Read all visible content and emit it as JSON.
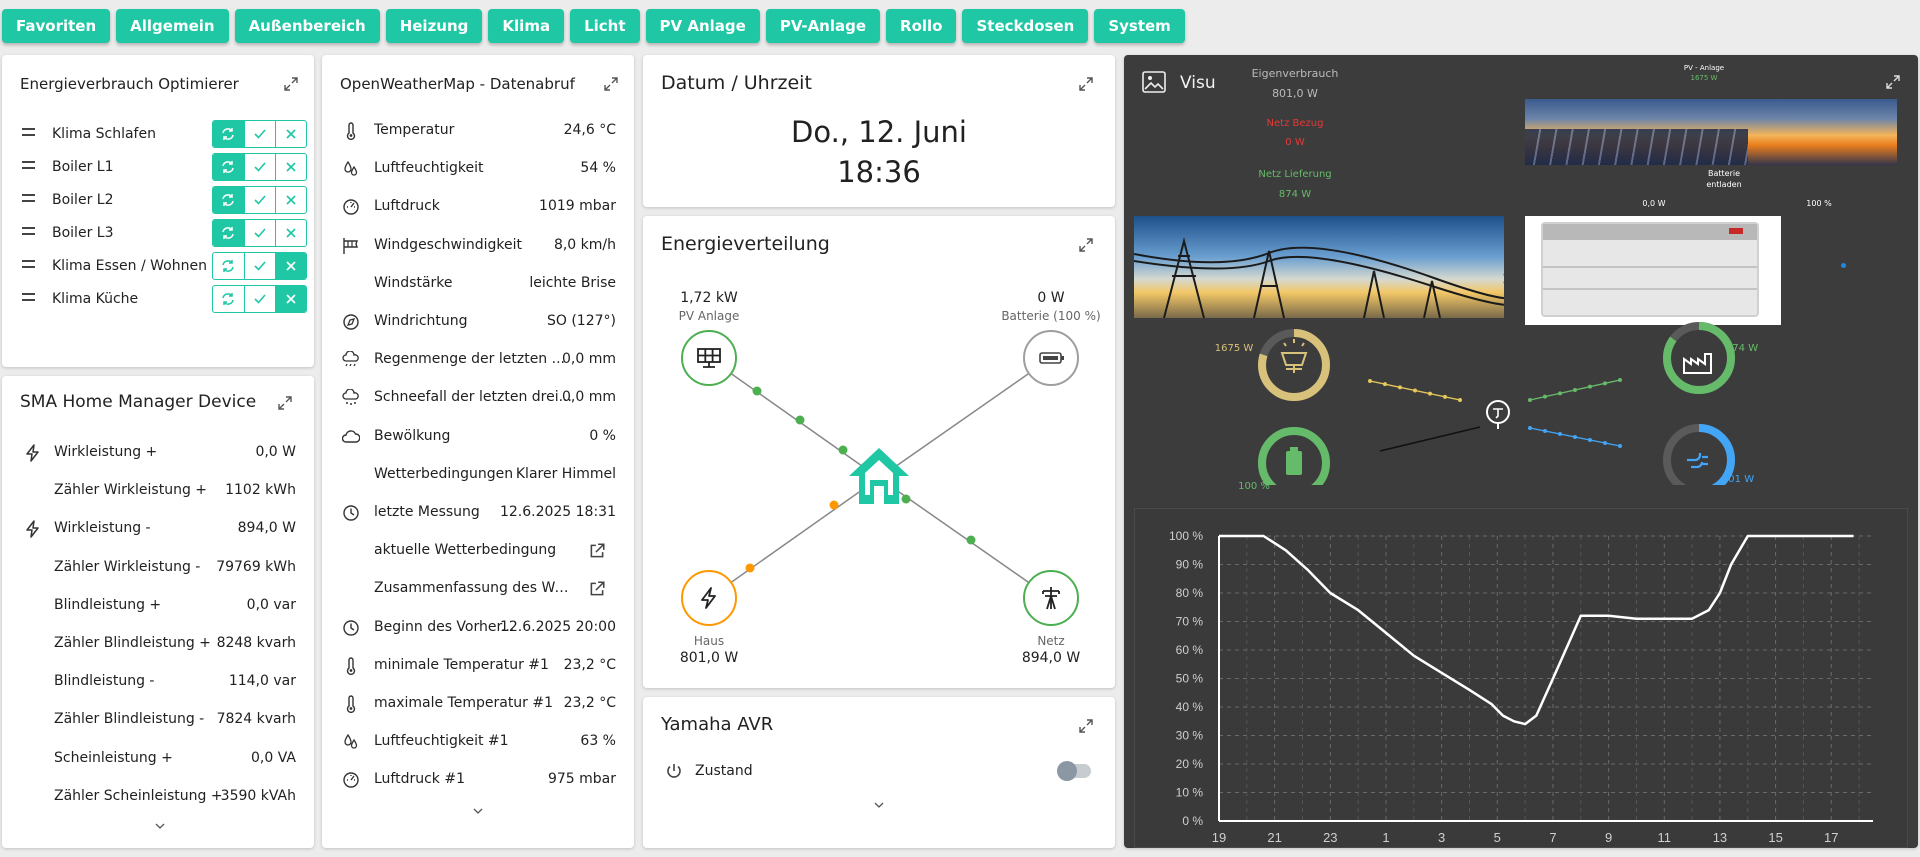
{
  "tabs": [
    "Favoriten",
    "Allgemein",
    "Außenbereich",
    "Heizung",
    "Klima",
    "Licht",
    "PV Anlage",
    "PV-Anlage",
    "Rollo",
    "Steckdosen",
    "System"
  ],
  "optimizer": {
    "title": "Energieverbrauch Optimierer",
    "items": [
      {
        "label": "Klima Schlafen",
        "active": "auto"
      },
      {
        "label": "Boiler L1",
        "active": "auto"
      },
      {
        "label": "Boiler L2",
        "active": "auto"
      },
      {
        "label": "Boiler L3",
        "active": "auto"
      },
      {
        "label": "Klima Essen / Wohnen",
        "active": "off"
      },
      {
        "label": "Klima Küche",
        "active": "off"
      }
    ]
  },
  "sma": {
    "title": "SMA Home Manager Device",
    "rows": [
      {
        "label": "Wirkleistung +",
        "value": "0,0 W",
        "icon": "lightning-icon"
      },
      {
        "label": "Zähler Wirkleistung +",
        "value": "1102 kWh",
        "icon": ""
      },
      {
        "label": "Wirkleistung -",
        "value": "894,0 W",
        "icon": "lightning-icon"
      },
      {
        "label": "Zähler Wirkleistung -",
        "value": "79769 kWh",
        "icon": ""
      },
      {
        "label": "Blindleistung +",
        "value": "0,0 var",
        "icon": ""
      },
      {
        "label": "Zähler Blindleistung +",
        "value": "8248 kvarh",
        "icon": ""
      },
      {
        "label": "Blindleistung -",
        "value": "114,0 var",
        "icon": ""
      },
      {
        "label": "Zähler Blindleistung -",
        "value": "7824 kvarh",
        "icon": ""
      },
      {
        "label": "Scheinleistung +",
        "value": "0,0 VA",
        "icon": ""
      },
      {
        "label": "Zähler Scheinleistung +",
        "value": "3590 kVAh",
        "icon": ""
      }
    ]
  },
  "weather": {
    "title": "OpenWeatherMap - Datenabruf",
    "rows": [
      {
        "label": "Temperatur",
        "value": "24,6 °C",
        "icon": "thermometer-icon"
      },
      {
        "label": "Luftfeuchtigkeit",
        "value": "54 %",
        "icon": "humidity-icon"
      },
      {
        "label": "Luftdruck",
        "value": "1019 mbar",
        "icon": "gauge-icon"
      },
      {
        "label": "Windgeschwindigkeit",
        "value": "8,0 km/h",
        "icon": "windsock-icon"
      },
      {
        "label": "Windstärke",
        "value": "leichte Brise",
        "icon": ""
      },
      {
        "label": "Windrichtung",
        "value": "SO (127°)",
        "icon": "compass-icon"
      },
      {
        "label": "Regenmenge der letzten ...",
        "value": "0,0 mm",
        "icon": "rain-icon"
      },
      {
        "label": "Schneefall der letzten drei...",
        "value": "0,0 mm",
        "icon": "snow-icon"
      },
      {
        "label": "Bewölkung",
        "value": "0 %",
        "icon": "cloud-icon"
      },
      {
        "label": "Wetterbedingungen",
        "value": "Klarer Himmel",
        "icon": ""
      },
      {
        "label": "letzte Messung",
        "value": "12.6.2025 18:31",
        "icon": "clock-icon"
      },
      {
        "label": "aktuelle Wetterbedingung",
        "value": "",
        "icon": "",
        "link": true
      },
      {
        "label": "Zusammenfassung des Wet...",
        "value": "",
        "icon": "",
        "link": true
      },
      {
        "label": "Beginn des Vorher...",
        "value": "12.6.2025 20:00",
        "icon": "clock-icon"
      },
      {
        "label": "minimale Temperatur #1",
        "value": "23,2 °C",
        "icon": "thermometer-icon"
      },
      {
        "label": "maximale Temperatur #1",
        "value": "23,2 °C",
        "icon": "thermometer-icon"
      },
      {
        "label": "Luftfeuchtigkeit #1",
        "value": "63 %",
        "icon": "humidity-icon"
      },
      {
        "label": "Luftdruck #1",
        "value": "975 mbar",
        "icon": "gauge-icon"
      }
    ]
  },
  "datetime": {
    "title": "Datum / Uhrzeit",
    "date": "Do., 12. Juni",
    "time": "18:36"
  },
  "energy": {
    "title": "Energieverteilung",
    "pv": {
      "value": "1,72 kW",
      "label": "PV Anlage"
    },
    "battery": {
      "value": "0 W",
      "label": "Batterie (100 %)"
    },
    "house": {
      "value": "801,0 W",
      "label": "Haus"
    },
    "grid": {
      "value": "894,0 W",
      "label": "Netz"
    },
    "colors": {
      "pv": "#4caf50",
      "battery": "#9e9e9e",
      "house": "#ff9800",
      "grid": "#4caf50",
      "home": "#1fc7a5"
    }
  },
  "yamaha": {
    "title": "Yamaha AVR",
    "state_label": "Zustand",
    "state_on": false
  },
  "visu": {
    "title": "Visu",
    "eigen_label": "Eigenverbrauch",
    "eigen_value": "801,0 W",
    "bezug_label": "Netz Bezug",
    "bezug_value": "0 W",
    "lieferung_label": "Netz Lieferung",
    "lieferung_value": "874 W",
    "pv_label": "PV - Anlage",
    "pv_value": "1675 W",
    "batt_label": "Batterie",
    "batt_state": "entladen",
    "batt_power": "0,0 W",
    "batt_pct": "100 %",
    "solar_value": "1675 W",
    "factory_value": "874 W",
    "battery_gauge": "100 %",
    "plug_value": "801 W",
    "solar_fill": 0.8,
    "factory_fill": 0.85,
    "battery_fill": 1.0,
    "plug_fill": 0.45,
    "colors": {
      "bezug": "#e53935",
      "lieferung": "#66bb6a",
      "solar": "#d8c17a",
      "green": "#66bb6a",
      "blue": "#42a5f5"
    }
  },
  "chart_data": {
    "type": "line",
    "title": "",
    "yticks": [
      "100 %",
      "90 %",
      "80 %",
      "70 %",
      "60 %",
      "50 %",
      "40 %",
      "30 %",
      "20 %",
      "10 %",
      "0 %"
    ],
    "xticks": [
      "19",
      "21",
      "23",
      "1",
      "3",
      "5",
      "7",
      "9",
      "11",
      "13",
      "15",
      "17"
    ],
    "ylim": [
      0,
      100
    ],
    "x": [
      19,
      19.8,
      20.6,
      21.4,
      22.2,
      23,
      24,
      25,
      26,
      27,
      28,
      28.8,
      29.2,
      29.6,
      30,
      30.4,
      31,
      32,
      33,
      34,
      35,
      36,
      36.6,
      37,
      37.4,
      38,
      38.8,
      39,
      41.8
    ],
    "values": [
      100,
      100,
      100,
      95,
      88,
      80,
      74,
      66,
      58,
      52,
      46,
      41,
      37,
      35,
      34,
      37,
      50,
      72,
      72,
      71,
      71,
      71,
      74,
      80,
      90,
      100,
      100,
      100,
      100
    ],
    "series": [
      {
        "color": "#ffffff"
      }
    ]
  }
}
